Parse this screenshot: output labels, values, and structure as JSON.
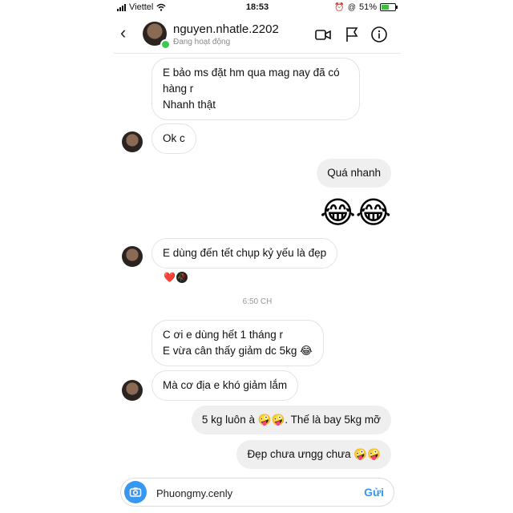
{
  "status_bar": {
    "carrier": "Viettel",
    "time": "18:53",
    "battery": "51%"
  },
  "header": {
    "username": "nguyen.nhatle.2202",
    "status": "Đang hoạt động",
    "icons": [
      "back-chevron-icon",
      "video-call-icon",
      "flag-icon",
      "info-icon"
    ]
  },
  "messages": [
    {
      "from": "them",
      "lines": [
        "E bảo ms đặt hm qua mag nay đã có",
        "hàng r",
        "Nhanh thật"
      ]
    },
    {
      "from": "them",
      "text": "Ok c"
    },
    {
      "from": "me",
      "text": "Quá nhanh"
    },
    {
      "from": "me",
      "emoji": "😂😂"
    },
    {
      "from": "them",
      "text": "E dùng đến tết chụp kỷ yếu là đẹp"
    },
    {
      "from": "them",
      "lines": [
        "C ơi e dùng hết 1 tháng r",
        "E vừa cân thấy giảm dc 5kg 😂"
      ]
    },
    {
      "from": "them",
      "text": "Mà cơ địa e khó giảm lắm"
    },
    {
      "from": "me",
      "text": "5 kg luôn à 🤪🤪. Thế là bay 5kg mỡ"
    },
    {
      "from": "me",
      "text": "Đẹp chưa ưngg chưa 🤪🤪"
    }
  ],
  "timestamp": "6:50 CH",
  "reactions": [
    "❤️",
    "🥀"
  ],
  "composer": {
    "value": "Phuongmy.cenly",
    "send_label": "Gửi"
  },
  "colors": {
    "accent": "#3897f0",
    "online": "#3cc94f",
    "outgoing_bubble": "#efefef"
  }
}
